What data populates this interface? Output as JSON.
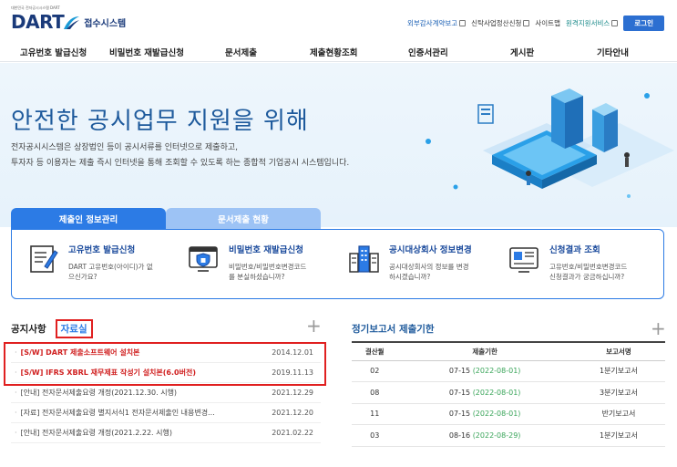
{
  "header": {
    "logo_small": "대한민국 전자공시시스템 DART",
    "logo_main": "DART",
    "logo_sub": "접수시스템",
    "links": [
      {
        "label": "외부감사계약보고",
        "style": "blue"
      },
      {
        "label": "신탁사업정산신청",
        "style": "normal"
      },
      {
        "label": "사이트맵",
        "style": "normal"
      },
      {
        "label": "원격지원서비스",
        "style": "green"
      }
    ],
    "login": "로그인"
  },
  "nav": [
    "고유번호 발급신청",
    "비밀번호 재발급신청",
    "문서제출",
    "제출현황조회",
    "인증서관리",
    "게시판",
    "기타안내"
  ],
  "hero": {
    "title": "안전한 공시업무 지원을 위해",
    "desc1": "전자공시시스템은 상장법인 등이 공시서류를 인터넷으로 제출하고,",
    "desc2": "투자자 등 이용자는 제출 즉시 인터넷을 통해 조회할 수 있도록 하는 종합적 기업공시 시스템입니다."
  },
  "tabs": [
    "제출인 정보관리",
    "문서제출 현황"
  ],
  "services": [
    {
      "title": "고유번호 발급신청",
      "desc1": "DART 고유번호(아이디)가 없",
      "desc2": "으신가요?",
      "icon": "form-icon"
    },
    {
      "title": "비밀번호 재발급신청",
      "desc1": "비밀번호/비밀번호변경코드",
      "desc2": "를 분실하셨습니까?",
      "icon": "lock-monitor-icon"
    },
    {
      "title": "공시대상회사 정보변경",
      "desc1": "공시대상회사의 정보를 변경",
      "desc2": "하시겠습니까?",
      "icon": "building-icon"
    },
    {
      "title": "신청결과 조회",
      "desc1": "고유번호/비밀번호변경코드",
      "desc2": "신청결과가 궁금하십니까?",
      "icon": "document-icon"
    }
  ],
  "notices": {
    "tab1": "공지사항",
    "tab2": "자료실",
    "rows": [
      {
        "text": "[S/W] DART 제출소프트웨어 설치본",
        "date": "2014.12.01",
        "highlight": true
      },
      {
        "text": "[S/W] IFRS XBRL 재무제표 작성기 설치본(6.0버전)",
        "date": "2019.11.13",
        "highlight": true
      },
      {
        "text": "[안내] 전자문서제출요령 개정(2021.12.30. 시행)",
        "date": "2021.12.29",
        "highlight": false
      },
      {
        "text": "[자료] 전자문서제출요령 별지서식1 전자문서제출인 내용변경...",
        "date": "2021.12.20",
        "highlight": false
      },
      {
        "text": "[안내] 전자문서제출요령 개정(2021.2.22. 시행)",
        "date": "2021.02.22",
        "highlight": false
      }
    ]
  },
  "reports": {
    "title": "정기보고서 제출기한",
    "columns": [
      "결산월",
      "제출기한",
      "보고서명"
    ],
    "rows": [
      {
        "month": "02",
        "deadline": "07-15",
        "extended": "(2022-08-01)",
        "name": "1분기보고서"
      },
      {
        "month": "08",
        "deadline": "07-15",
        "extended": "(2022-08-01)",
        "name": "3분기보고서"
      },
      {
        "month": "11",
        "deadline": "07-15",
        "extended": "(2022-08-01)",
        "name": "반기보고서"
      },
      {
        "month": "03",
        "deadline": "08-16",
        "extended": "(2022-08-29)",
        "name": "1분기보고서"
      }
    ]
  }
}
